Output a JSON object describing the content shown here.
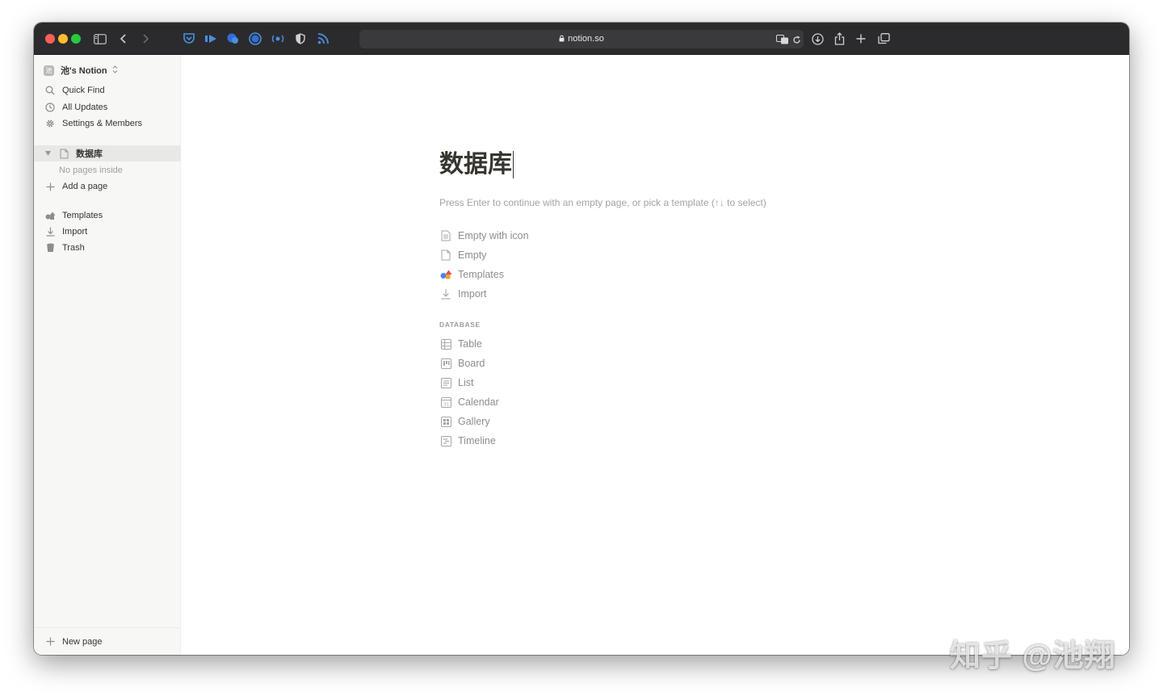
{
  "browser": {
    "url": "notion.so"
  },
  "sidebar": {
    "workspace": {
      "badge": "池",
      "name": "池's Notion"
    },
    "quick_links": [
      {
        "label": "Quick Find",
        "icon": "search-icon"
      },
      {
        "label": "All Updates",
        "icon": "clock-icon"
      },
      {
        "label": "Settings & Members",
        "icon": "gear-icon"
      }
    ],
    "page": {
      "title": "数据库",
      "empty_text": "No pages inside"
    },
    "add_page": "Add a page",
    "bottom_links": [
      {
        "label": "Templates",
        "icon": "templates-icon"
      },
      {
        "label": "Import",
        "icon": "download-icon"
      },
      {
        "label": "Trash",
        "icon": "trash-icon"
      }
    ],
    "new_page": "New page"
  },
  "main": {
    "title": "数据库",
    "hint": "Press Enter to continue with an empty page, or pick a template (↑↓ to select)",
    "options": [
      {
        "label": "Empty with icon",
        "icon": "document-lines-icon"
      },
      {
        "label": "Empty",
        "icon": "document-icon"
      },
      {
        "label": "Templates",
        "icon": "templates-icon"
      },
      {
        "label": "Import",
        "icon": "download-icon"
      }
    ],
    "database_label": "DATABASE",
    "database_options": [
      {
        "label": "Table",
        "icon": "table-icon"
      },
      {
        "label": "Board",
        "icon": "board-icon"
      },
      {
        "label": "List",
        "icon": "list-icon"
      },
      {
        "label": "Calendar",
        "icon": "calendar-icon"
      },
      {
        "label": "Gallery",
        "icon": "gallery-icon"
      },
      {
        "label": "Timeline",
        "icon": "timeline-icon"
      }
    ]
  },
  "watermark": "知乎 @池翔",
  "colors": {
    "titlebar": "#2b2b2d",
    "sidebar_bg": "#f7f7f5",
    "text": "#37352f",
    "muted": "#a5a39e"
  }
}
